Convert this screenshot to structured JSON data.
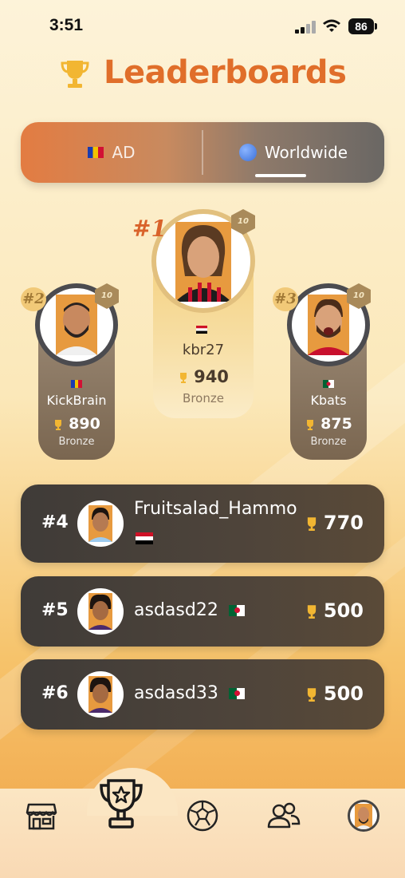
{
  "status_bar": {
    "time": "3:51",
    "battery": "86"
  },
  "header": {
    "title": "Leaderboards",
    "icon": "trophy-icon"
  },
  "tabs": [
    {
      "label": "AD",
      "icon": "flag-ad-icon",
      "active": false
    },
    {
      "label": "Worldwide",
      "icon": "globe-icon",
      "active": true
    }
  ],
  "podium": {
    "first": {
      "rank": "#1",
      "name": "kbr27",
      "score": "940",
      "tier": "Bronze",
      "level": "10",
      "country": "EG"
    },
    "second": {
      "rank": "#2",
      "name": "KickBrain",
      "score": "890",
      "tier": "Bronze",
      "level": "10",
      "country": "AD"
    },
    "third": {
      "rank": "#3",
      "name": "Kbats",
      "score": "875",
      "tier": "Bronze",
      "level": "10",
      "country": "DZ"
    }
  },
  "list": [
    {
      "rank": "#4",
      "name": "Fruitsalad_Hammo",
      "score": "770",
      "country": "EG"
    },
    {
      "rank": "#5",
      "name": "asdasd22",
      "score": "500",
      "country": "DZ"
    },
    {
      "rank": "#6",
      "name": "asdasd33",
      "score": "500",
      "country": "DZ"
    }
  ],
  "nav": [
    "store-icon",
    "trophy-icon",
    "soccer-ball-icon",
    "friends-icon",
    "profile-avatar"
  ],
  "colors": {
    "title": "#e06e2a",
    "gold": "#f2b632",
    "row_bg": "#3f3b38"
  }
}
